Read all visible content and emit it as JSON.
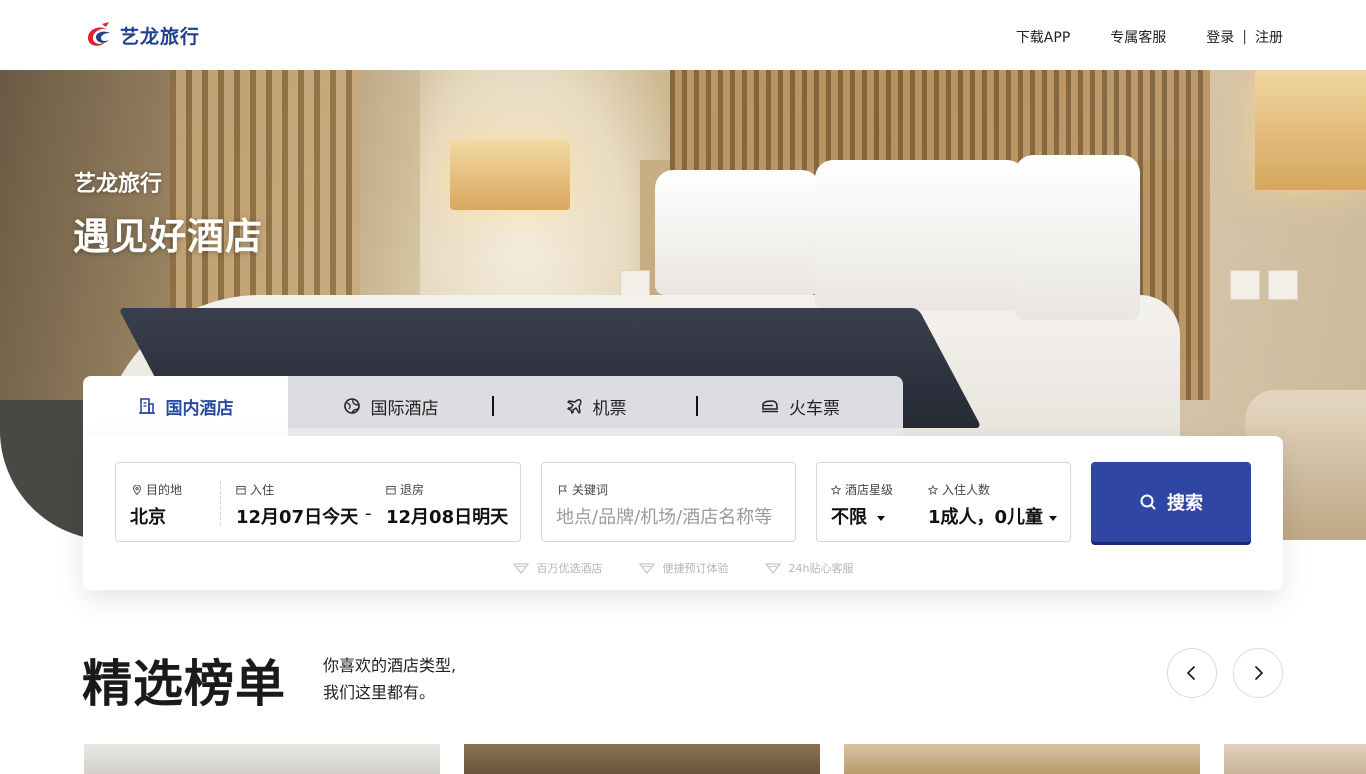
{
  "header": {
    "logo_text": "艺龙旅行",
    "nav": {
      "download_app": "下载APP",
      "customer_service": "专属客服",
      "login": "登录",
      "separator": "|",
      "register": "注册"
    }
  },
  "hero": {
    "subtitle": "艺龙旅行",
    "title": "遇见好酒店"
  },
  "tabs": [
    {
      "label": "国内酒店",
      "icon": "building-icon",
      "active": true
    },
    {
      "label": "国际酒店",
      "icon": "globe-icon",
      "active": false
    },
    {
      "label": "机票",
      "icon": "plane-icon",
      "active": false
    },
    {
      "label": "火车票",
      "icon": "train-icon",
      "active": false
    }
  ],
  "search": {
    "destination": {
      "label": "目的地",
      "value": "北京"
    },
    "checkin": {
      "label": "入住",
      "value": "12月07日今天"
    },
    "date_separator": "-",
    "checkout": {
      "label": "退房",
      "value": "12月08日明天"
    },
    "keyword": {
      "label": "关键词",
      "placeholder": "地点/品牌/机场/酒店名称等"
    },
    "star": {
      "label": "酒店星级",
      "value": "不限"
    },
    "guests": {
      "label": "入住人数",
      "value": "1成人，0儿童"
    },
    "button_label": "搜索"
  },
  "features": [
    "百万优选酒店",
    "便捷预订体验",
    "24h贴心客服"
  ],
  "section": {
    "title": "精选榜单",
    "desc_line1": "你喜欢的酒店类型,",
    "desc_line2": "我们这里都有。"
  },
  "colors": {
    "brand_blue": "#2f46a4",
    "active_tab_text": "#2b4ba3",
    "logo_red": "#d9232e"
  }
}
